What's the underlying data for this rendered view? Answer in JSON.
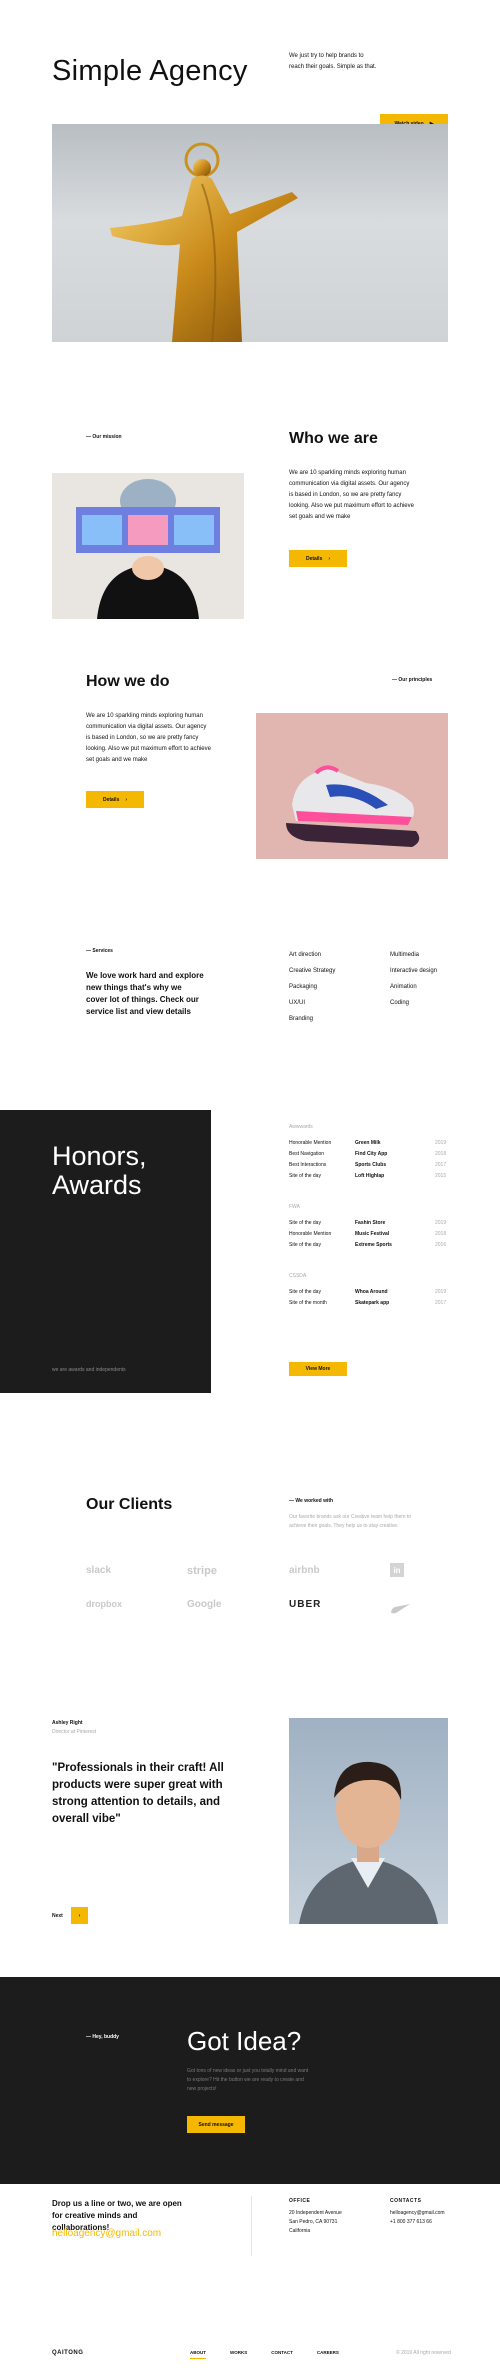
{
  "hero": {
    "title": "Simple Agency",
    "tagline": "We just try to help brands to reach their goals. Simple as that.",
    "video_button": "Watch video"
  },
  "mission": {
    "label": "— Our mission",
    "title": "Who we are",
    "body": "We are 10 sparkling minds exploring human communication via digital assets. Our agency is based in London, so we are pretty fancy looking. Also we put maximum effort to achieve set goals and we make",
    "button": "Details"
  },
  "principles": {
    "title": "How we do",
    "label": "— Our principles",
    "body": "We are 10 sparkling minds exploring human communication via digital assets. Our agency is based in London, so we are pretty fancy looking. Also we put maximum effort to achieve set goals and we make",
    "button": "Details"
  },
  "services": {
    "label": "— Services",
    "heading": "We love work hard and explore new things that's why we cover lot of things. Check our service list and view details",
    "col1": [
      "Art direction",
      "Creative Strategy",
      "Packaging",
      "UX/UI",
      "Branding"
    ],
    "col2": [
      "Multimedia",
      "Interactive design",
      "Animation",
      "Coding"
    ]
  },
  "awards": {
    "title_line1": "Honors,",
    "title_line2": "Awards",
    "caption": "we are awards and independents",
    "groups": [
      {
        "name": "Awwwards",
        "rows": [
          {
            "award": "Honorable Mention",
            "project": "Green Milk",
            "year": "2019"
          },
          {
            "award": "Best Navigation",
            "project": "Find City App",
            "year": "2018"
          },
          {
            "award": "Best Interactions",
            "project": "Sports Clubs",
            "year": "2017"
          },
          {
            "award": "Site of the day",
            "project": "Loft Highlap",
            "year": "2015"
          }
        ]
      },
      {
        "name": "FWA",
        "rows": [
          {
            "award": "Site of the day",
            "project": "Fashin Store",
            "year": "2019"
          },
          {
            "award": "Honorable Mention",
            "project": "Music Festival",
            "year": "2018"
          },
          {
            "award": "Site of the day",
            "project": "Extreme Sports",
            "year": "2016"
          }
        ]
      },
      {
        "name": "CSSDA",
        "rows": [
          {
            "award": "Site of the day",
            "project": "Whoa Around",
            "year": "2019"
          },
          {
            "award": "Site of the month",
            "project": "Skatepark app",
            "year": "2017"
          }
        ]
      }
    ],
    "button": "View More"
  },
  "clients": {
    "title": "Our Clients",
    "label": "— We worked with",
    "body": "Our favorite brands ask our Creative team help them to achieve their goals. They help us to stay creative.",
    "logos": [
      "slack",
      "stripe",
      "airbnb",
      "in",
      "dropbox",
      "Google",
      "UBER",
      "nike"
    ]
  },
  "testimonial": {
    "name": "Ashley Right",
    "role": "Director at Pinterest",
    "quote": "\"Professionals in their craft! All products were super great with strong attention to details, and overall vibe\"",
    "next_label": "Next"
  },
  "cta": {
    "label": "— Hey, buddy",
    "title": "Got Idea?",
    "body": "Got tons of new ideas or just you totally mind and want to explore? Hit the button we are ready to create and new projects!",
    "button": "Send message"
  },
  "footer": {
    "pitch": "Drop us a line or two, we are open for creative minds and collaborations!",
    "email_link": "helloagency@gmail.com",
    "office_label": "Office",
    "office_lines": [
      "20 Independent Avenue",
      "San Pedro, CA 90731",
      "California"
    ],
    "contacts_label": "Contacts",
    "contacts_lines": [
      "helloagency@gmail.com",
      "+1 800 377 613 66"
    ],
    "brand": "QAITONG",
    "nav": [
      "About",
      "Works",
      "Contact",
      "Careers"
    ],
    "copyright": "© 2019 All right reserved"
  },
  "colors": {
    "accent": "#f5b800",
    "dark": "#1c1c1c"
  }
}
